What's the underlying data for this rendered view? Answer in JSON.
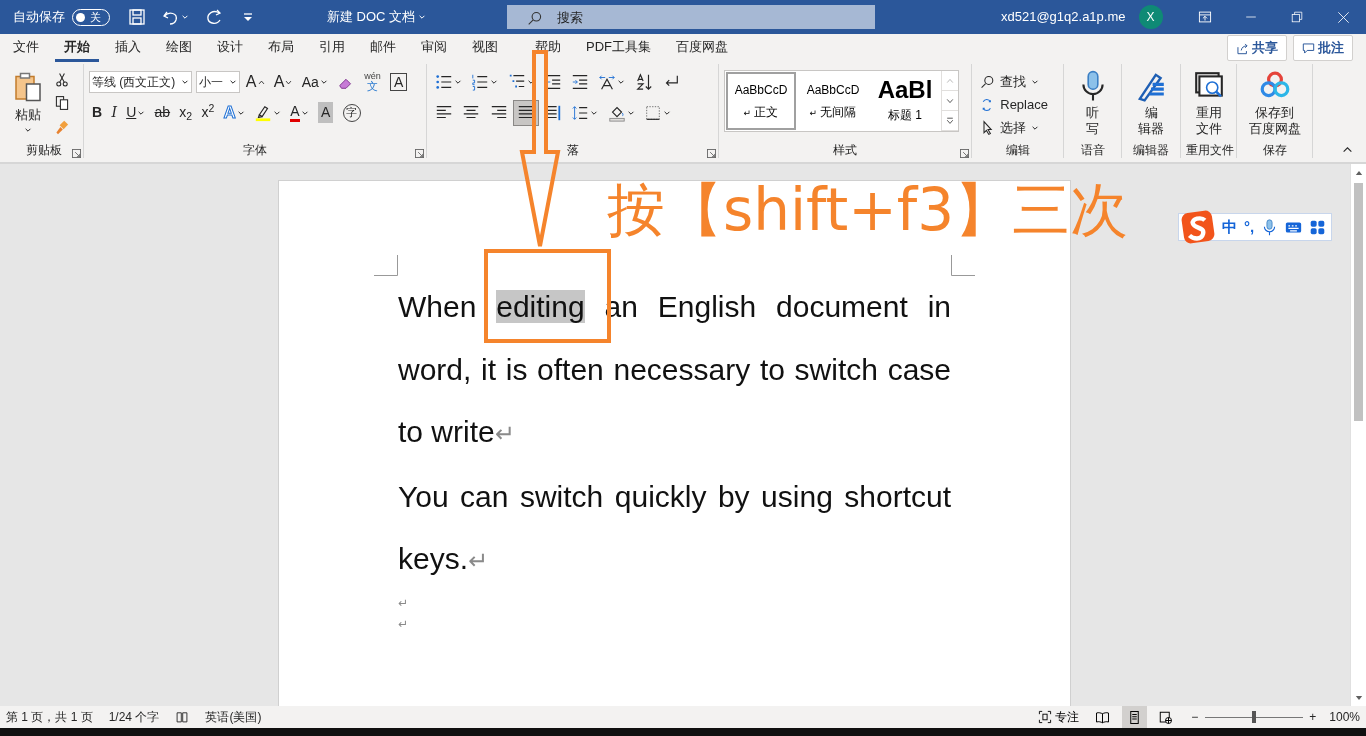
{
  "title_bar": {
    "autosave": {
      "label": "自动保存",
      "on": false,
      "state_text": "关"
    },
    "quick_access": [
      {
        "kind": "save",
        "caret": false
      },
      {
        "kind": "undo",
        "caret": true
      },
      {
        "kind": "redo",
        "caret": false
      },
      {
        "kind": "customize",
        "caret": false
      }
    ],
    "title": "新建 DOC 文档",
    "search": {
      "placeholder": "搜索"
    },
    "account": "xd521@g1q2.a1p.me",
    "avatar": "X"
  },
  "tabs": [
    {
      "label": "文件",
      "selected": false
    },
    {
      "label": "开始",
      "selected": true
    },
    {
      "label": "插入",
      "selected": false
    },
    {
      "label": "绘图",
      "selected": false
    },
    {
      "label": "设计",
      "selected": false
    },
    {
      "label": "布局",
      "selected": false
    },
    {
      "label": "引用",
      "selected": false
    },
    {
      "label": "邮件",
      "selected": false
    },
    {
      "label": "审阅",
      "selected": false
    },
    {
      "label": "视图",
      "selected": false
    },
    {
      "label": "帮助",
      "selected": false
    },
    {
      "label": "PDF工具集",
      "selected": false
    },
    {
      "label": "百度网盘",
      "selected": false
    }
  ],
  "actions": [
    {
      "kind": "share",
      "label": "共享"
    },
    {
      "kind": "comment",
      "label": "批注"
    }
  ],
  "ribbon": [
    {
      "kind": "clipboard",
      "label": "剪贴板",
      "launcher": true,
      "paste": "粘贴",
      "tools": [
        {
          "kind": "cut"
        },
        {
          "kind": "copy"
        },
        {
          "kind": "painter"
        }
      ]
    },
    {
      "kind": "toolbars",
      "label": "字体",
      "launcher": true,
      "toolbars": [
        {
          "items": [
            {
              "kind": "select",
              "value": "等线 (西文正文)"
            },
            {
              "kind": "select",
              "value": "小一"
            },
            {
              "kind": "grow",
              "label": "A"
            },
            {
              "kind": "shrink",
              "label": "A"
            },
            {
              "kind": "case",
              "label": "Aa",
              "caret": true
            },
            {
              "kind": "clear"
            },
            {
              "kind": "phonetic",
              "ruby": "wén",
              "label": "文"
            },
            {
              "kind": "border-char",
              "label": "A"
            }
          ]
        },
        {
          "items": [
            {
              "kind": "bold",
              "label": "B"
            },
            {
              "kind": "italic",
              "label": "I"
            },
            {
              "kind": "underline",
              "label": "U",
              "caret": true
            },
            {
              "kind": "strike",
              "label": "ab"
            },
            {
              "kind": "sub",
              "label": "x$_{2}$"
            },
            {
              "kind": "sup",
              "label": "x$^{2}$"
            },
            {
              "kind": "effects",
              "label": "A",
              "caret": true
            },
            {
              "kind": "highlight",
              "caret": true
            },
            {
              "kind": "fontcolor",
              "label": "A",
              "caret": true
            },
            {
              "kind": "shading",
              "label": "A"
            },
            {
              "kind": "enclose",
              "label": "字"
            }
          ]
        }
      ]
    },
    {
      "kind": "toolbars",
      "label": "落",
      "launcher": true,
      "toolbars": [
        {
          "items": [
            {
              "kind": "bullets",
              "caret": true
            },
            {
              "kind": "numbering",
              "caret": true
            },
            {
              "kind": "multilevel",
              "caret": true
            },
            {
              "kind": "outdent"
            },
            {
              "kind": "indent"
            },
            {
              "kind": "asian",
              "caret": true
            },
            {
              "kind": "sort"
            },
            {
              "kind": "marks"
            }
          ]
        },
        {
          "items": [
            {
              "kind": "align-left",
              "selected": false
            },
            {
              "kind": "align-center",
              "selected": false
            },
            {
              "kind": "align-right",
              "selected": false
            },
            {
              "kind": "justify",
              "selected": true
            },
            {
              "kind": "distribute",
              "selected": false
            },
            {
              "kind": "spacing",
              "caret": true,
              "selected": false
            },
            {
              "kind": "fill",
              "caret": true,
              "selected": false
            },
            {
              "kind": "borders",
              "caret": true,
              "selected": false
            }
          ]
        }
      ]
    },
    {
      "kind": "styles",
      "label": "样式",
      "launcher": true,
      "items": [
        {
          "kind": "normal",
          "sample": "AaBbCcD",
          "name": "正文",
          "mark": "↵",
          "selected": true
        },
        {
          "kind": "normal",
          "sample": "AaBbCcD",
          "name": "无间隔",
          "mark": "↵",
          "selected": false
        },
        {
          "kind": "heading",
          "sample": "AaBl",
          "name": "标题 1",
          "selected": false
        }
      ]
    },
    {
      "kind": "stack",
      "label": "编辑",
      "items": [
        {
          "kind": "find",
          "label": "查找",
          "caret": true
        },
        {
          "kind": "replace",
          "label": "Replace",
          "caret": false
        },
        {
          "kind": "select-tool",
          "label": "选择",
          "caret": true
        }
      ]
    },
    {
      "kind": "large",
      "label": "语音",
      "button": {
        "kind": "mic",
        "lines": [
          "听",
          "写"
        ]
      }
    },
    {
      "kind": "large",
      "label": "编辑器",
      "button": {
        "kind": "pen",
        "lines": [
          "编",
          "辑器"
        ]
      }
    },
    {
      "kind": "large",
      "label": "重用文件",
      "button": {
        "kind": "reuse",
        "lines": [
          "重用",
          "文件"
        ]
      }
    },
    {
      "kind": "large",
      "label": "保存",
      "button": {
        "kind": "cloud",
        "lines": [
          "保存到",
          "百度网盘"
        ]
      }
    }
  ],
  "document": {
    "paragraphs": [
      {
        "kind": "text",
        "segments": [
          {
            "text": "When ",
            "selected": false
          },
          {
            "text": "editing",
            "selected": true
          },
          {
            "text": " an English document in word, it is often necessary to switch case to write",
            "selected": false
          }
        ],
        "end_mark": "↵"
      },
      {
        "kind": "text",
        "segments": [
          {
            "text": "You can switch quickly by using shortcut keys.",
            "selected": false
          }
        ],
        "end_mark": "↵"
      },
      {
        "kind": "empty",
        "end_mark": "↵"
      },
      {
        "kind": "empty",
        "end_mark": "↵"
      }
    ]
  },
  "annotation": {
    "text": "按【shift+f3】三次"
  },
  "ime_toolbar": [
    {
      "kind": "logo"
    },
    {
      "kind": "text",
      "label": "中"
    },
    {
      "kind": "text",
      "label": "°,"
    },
    {
      "kind": "mic"
    },
    {
      "kind": "keyboard"
    },
    {
      "kind": "grid"
    }
  ],
  "status_bar": {
    "left": [
      {
        "kind": "text",
        "label": "第 1 页，共 1 页"
      },
      {
        "kind": "text",
        "label": "1/24 个字"
      },
      {
        "kind": "proofing"
      },
      {
        "kind": "text",
        "label": "英语(美国)"
      }
    ],
    "focus": "专注",
    "views": [
      {
        "kind": "read",
        "selected": false
      },
      {
        "kind": "print",
        "selected": true
      },
      {
        "kind": "web",
        "selected": false
      }
    ],
    "zoom": {
      "minus": "−",
      "plus": "+",
      "level": 0.5,
      "reading": "100%"
    }
  }
}
